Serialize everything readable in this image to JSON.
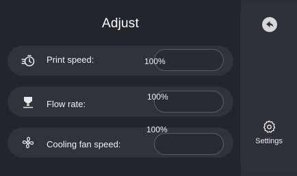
{
  "title": "Adjust",
  "rows": [
    {
      "label": "Print speed:",
      "value": "100%",
      "icon": "print-speed-icon"
    },
    {
      "label": "Flow rate:",
      "value": "100%",
      "icon": "flow-rate-icon"
    },
    {
      "label": "Cooling fan speed:",
      "value": "100%",
      "icon": "fan-icon"
    }
  ],
  "sidebar": {
    "back_icon": "back-arrow-icon",
    "settings_label": "Settings",
    "settings_icon": "gear-icon"
  }
}
